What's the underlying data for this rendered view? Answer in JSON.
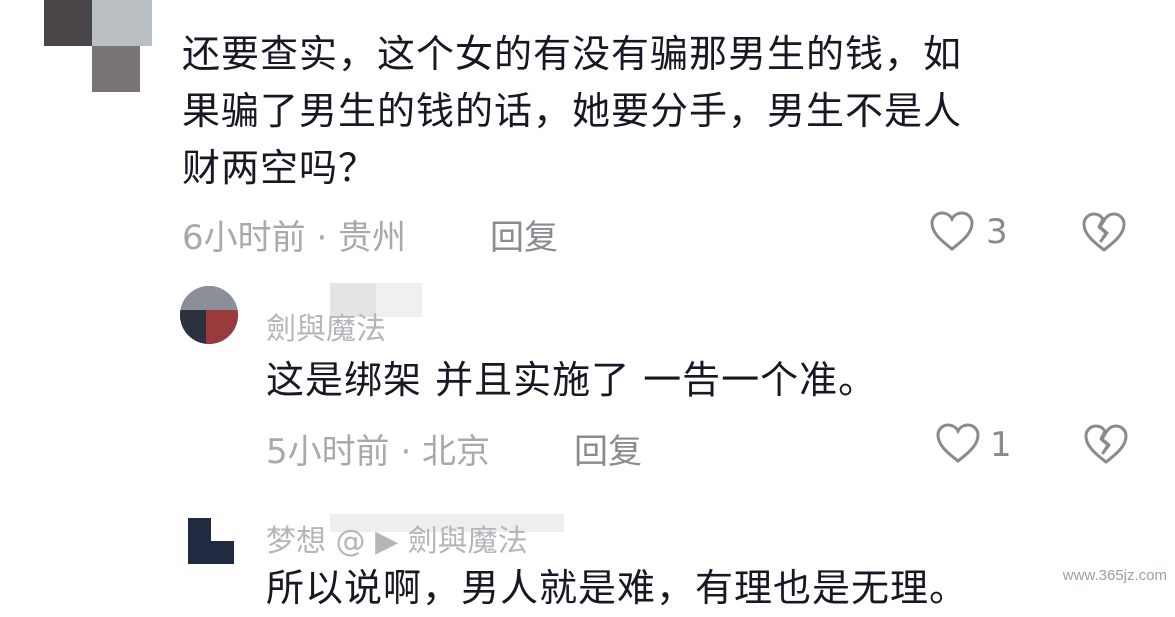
{
  "comments": [
    {
      "lines": [
        "还要查实，这个女的有没有骗那男生的钱，如",
        "果骗了男生的钱的话，她要分手，男生不是人",
        "财两空吗？"
      ],
      "time": "6小时前 · 贵州",
      "reply_label": "回复",
      "likes": "3"
    },
    {
      "username": "劍與魔法",
      "text": "这是绑架 并且实施了 一告一个准。",
      "time": "5小时前 · 北京",
      "reply_label": "回复",
      "likes": "1"
    },
    {
      "username": "梦想 @ ▶ 劍與魔法",
      "text": "所以说啊，男人就是难，有理也是无理。"
    }
  ],
  "watermark": "www.365jz.com",
  "icons": {
    "like": "heart-outline-icon",
    "dislike": "broken-heart-icon"
  },
  "colors": {
    "text": "#161823",
    "meta": "#a8a8ad",
    "muted": "#8a8a90"
  }
}
